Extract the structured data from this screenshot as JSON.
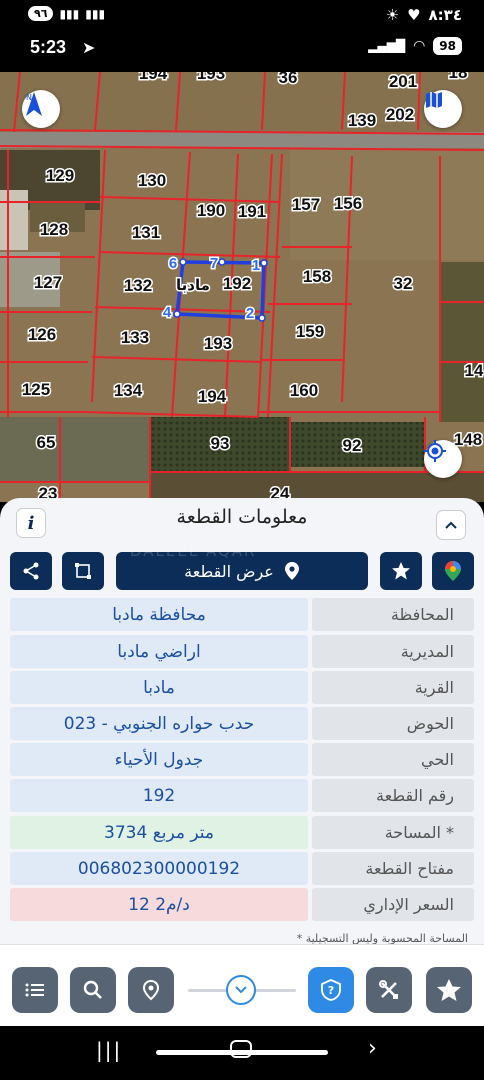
{
  "status_bar_top": {
    "notification_count": "٩٦",
    "time": "٨:٣٤"
  },
  "status_bar": {
    "time": "5:23",
    "battery": "98"
  },
  "map": {
    "labels": {
      "l194t": "194",
      "l193t": "193",
      "l36": "36",
      "l201": "201",
      "l18": "18",
      "l139": "139",
      "l202": "202",
      "l129": "129",
      "l130": "130",
      "l190": "190",
      "l191": "191",
      "l157": "157",
      "l156": "156",
      "l128": "128",
      "l131": "131",
      "l127": "127",
      "l132": "132",
      "l192": "192",
      "l158": "158",
      "l32": "32",
      "l126": "126",
      "l133": "133",
      "l193": "193",
      "l159": "159",
      "l125": "125",
      "l134": "134",
      "l194": "194",
      "l160": "160",
      "l14": "14",
      "l65": "65",
      "l93": "93",
      "l92": "92",
      "l148": "148",
      "l23": "23",
      "l24": "24"
    },
    "plot_arabic_label": "مادبا",
    "vertex_labels": [
      "1",
      "2",
      "4",
      "6",
      "7"
    ]
  },
  "sheet": {
    "title": "معلومات القطعة",
    "show_plot_button": "عرض القطعة",
    "watermark": "DALEEL AQAR",
    "rows": [
      {
        "key": "المحافظة",
        "value": "محافظة مادبا",
        "bg": "#dfeaf6"
      },
      {
        "key": "المديرية",
        "value": "اراضي مادبا",
        "bg": "#dfeaf6"
      },
      {
        "key": "القرية",
        "value": "مادبا",
        "bg": "#dfeaf6"
      },
      {
        "key": "الحوض",
        "value": "حدب حواره الجنوبي - 023",
        "bg": "#dfeaf6"
      },
      {
        "key": "الحي",
        "value": "جدول الأحياء",
        "bg": "#dfeaf6"
      },
      {
        "key": "رقم القطعة",
        "value": "192",
        "bg": "#dfeaf6"
      },
      {
        "key": "المساحة *",
        "value": "3734  متر مربع",
        "bg": "#e0f2e3"
      },
      {
        "key": "مفتاح القطعة",
        "value": "006802300000192",
        "bg": "#dfeaf6"
      },
      {
        "key": "السعر الإداري",
        "value": "12 د/م2",
        "bg": "#f6dadc"
      }
    ],
    "footnote": "* المساحة المحسوبة وليس التسجيلية"
  },
  "colors": {
    "navy": "#0c2d58",
    "parcel_line": "#e8232a",
    "selected_outline": "#1f3fe0",
    "toolbar_button": "#576474",
    "highlight_blue": "#2f8ae6"
  },
  "icons": [
    "north-arrow-icon",
    "map-layers-icon",
    "gps-target-icon",
    "info-icon",
    "chevron-up-icon",
    "share-icon",
    "crop-icon",
    "location-pin-icon",
    "star-icon",
    "google-maps-icon",
    "list-icon",
    "search-icon",
    "pin-icon",
    "chevron-down-icon",
    "help-icon",
    "tools-icon"
  ]
}
